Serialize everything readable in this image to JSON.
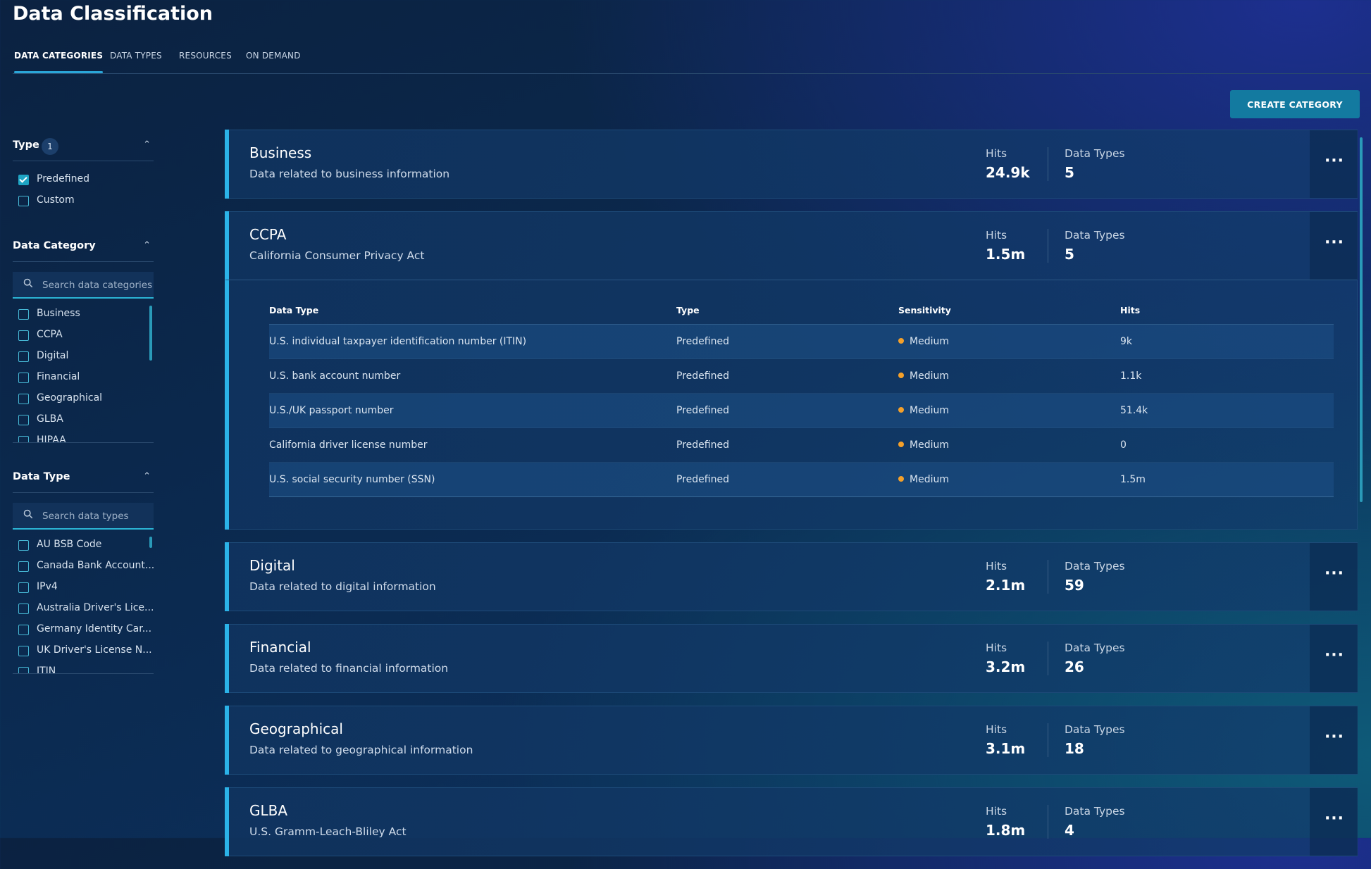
{
  "page": {
    "title": "Data Classification"
  },
  "tabs": [
    {
      "label": "DATA CATEGORIES",
      "active": true
    },
    {
      "label": "DATA TYPES",
      "active": false
    },
    {
      "label": "RESOURCES",
      "active": false
    },
    {
      "label": "ON DEMAND",
      "active": false
    }
  ],
  "create_button": {
    "label": "CREATE CATEGORY"
  },
  "colors": {
    "accent": "#2bb3e8",
    "button": "#137aa0",
    "sensitivity_medium": "#f4a02a"
  },
  "sidebar": {
    "type": {
      "title": "Type",
      "badge": "1",
      "options": [
        {
          "label": "Predefined",
          "checked": true
        },
        {
          "label": "Custom",
          "checked": false
        }
      ]
    },
    "data_category": {
      "title": "Data Category",
      "search_placeholder": "Search data categories",
      "items": [
        "Business",
        "CCPA",
        "Digital",
        "Financial",
        "Geographical",
        "GLBA",
        "HIPAA"
      ]
    },
    "data_type": {
      "title": "Data Type",
      "search_placeholder": "Search data types",
      "items": [
        "AU BSB Code",
        "Canada Bank Account...",
        "IPv4",
        "Australia Driver's Lice...",
        "Germany Identity Car...",
        "UK Driver's License N...",
        "ITIN"
      ]
    }
  },
  "stat_labels": {
    "hits": "Hits",
    "data_types": "Data Types"
  },
  "categories": [
    {
      "name": "Business",
      "description": "Data related to business information",
      "hits": "24.9k",
      "data_types": "5"
    },
    {
      "name": "CCPA",
      "description": "California Consumer Privacy Act",
      "hits": "1.5m",
      "data_types": "5"
    },
    {
      "name": "Digital",
      "description": "Data related to digital information",
      "hits": "2.1m",
      "data_types": "59"
    },
    {
      "name": "Financial",
      "description": "Data related to financial information",
      "hits": "3.2m",
      "data_types": "26"
    },
    {
      "name": "Geographical",
      "description": "Data related to geographical information",
      "hits": "3.1m",
      "data_types": "18"
    },
    {
      "name": "GLBA",
      "description": "U.S. Gramm-Leach-Bliley Act",
      "hits": "1.8m",
      "data_types": "4"
    }
  ],
  "ccpa_table": {
    "headers": [
      "Data Type",
      "Type",
      "Sensitivity",
      "Hits"
    ],
    "rows": [
      {
        "data_type": "U.S. individual taxpayer identification number (ITIN)",
        "type": "Predefined",
        "sensitivity": "Medium",
        "hits": "9k"
      },
      {
        "data_type": "U.S. bank account number",
        "type": "Predefined",
        "sensitivity": "Medium",
        "hits": "1.1k"
      },
      {
        "data_type": "U.S./UK passport number",
        "type": "Predefined",
        "sensitivity": "Medium",
        "hits": "51.4k"
      },
      {
        "data_type": "California driver license number",
        "type": "Predefined",
        "sensitivity": "Medium",
        "hits": "0"
      },
      {
        "data_type": "U.S. social security number (SSN)",
        "type": "Predefined",
        "sensitivity": "Medium",
        "hits": "1.5m"
      }
    ]
  }
}
